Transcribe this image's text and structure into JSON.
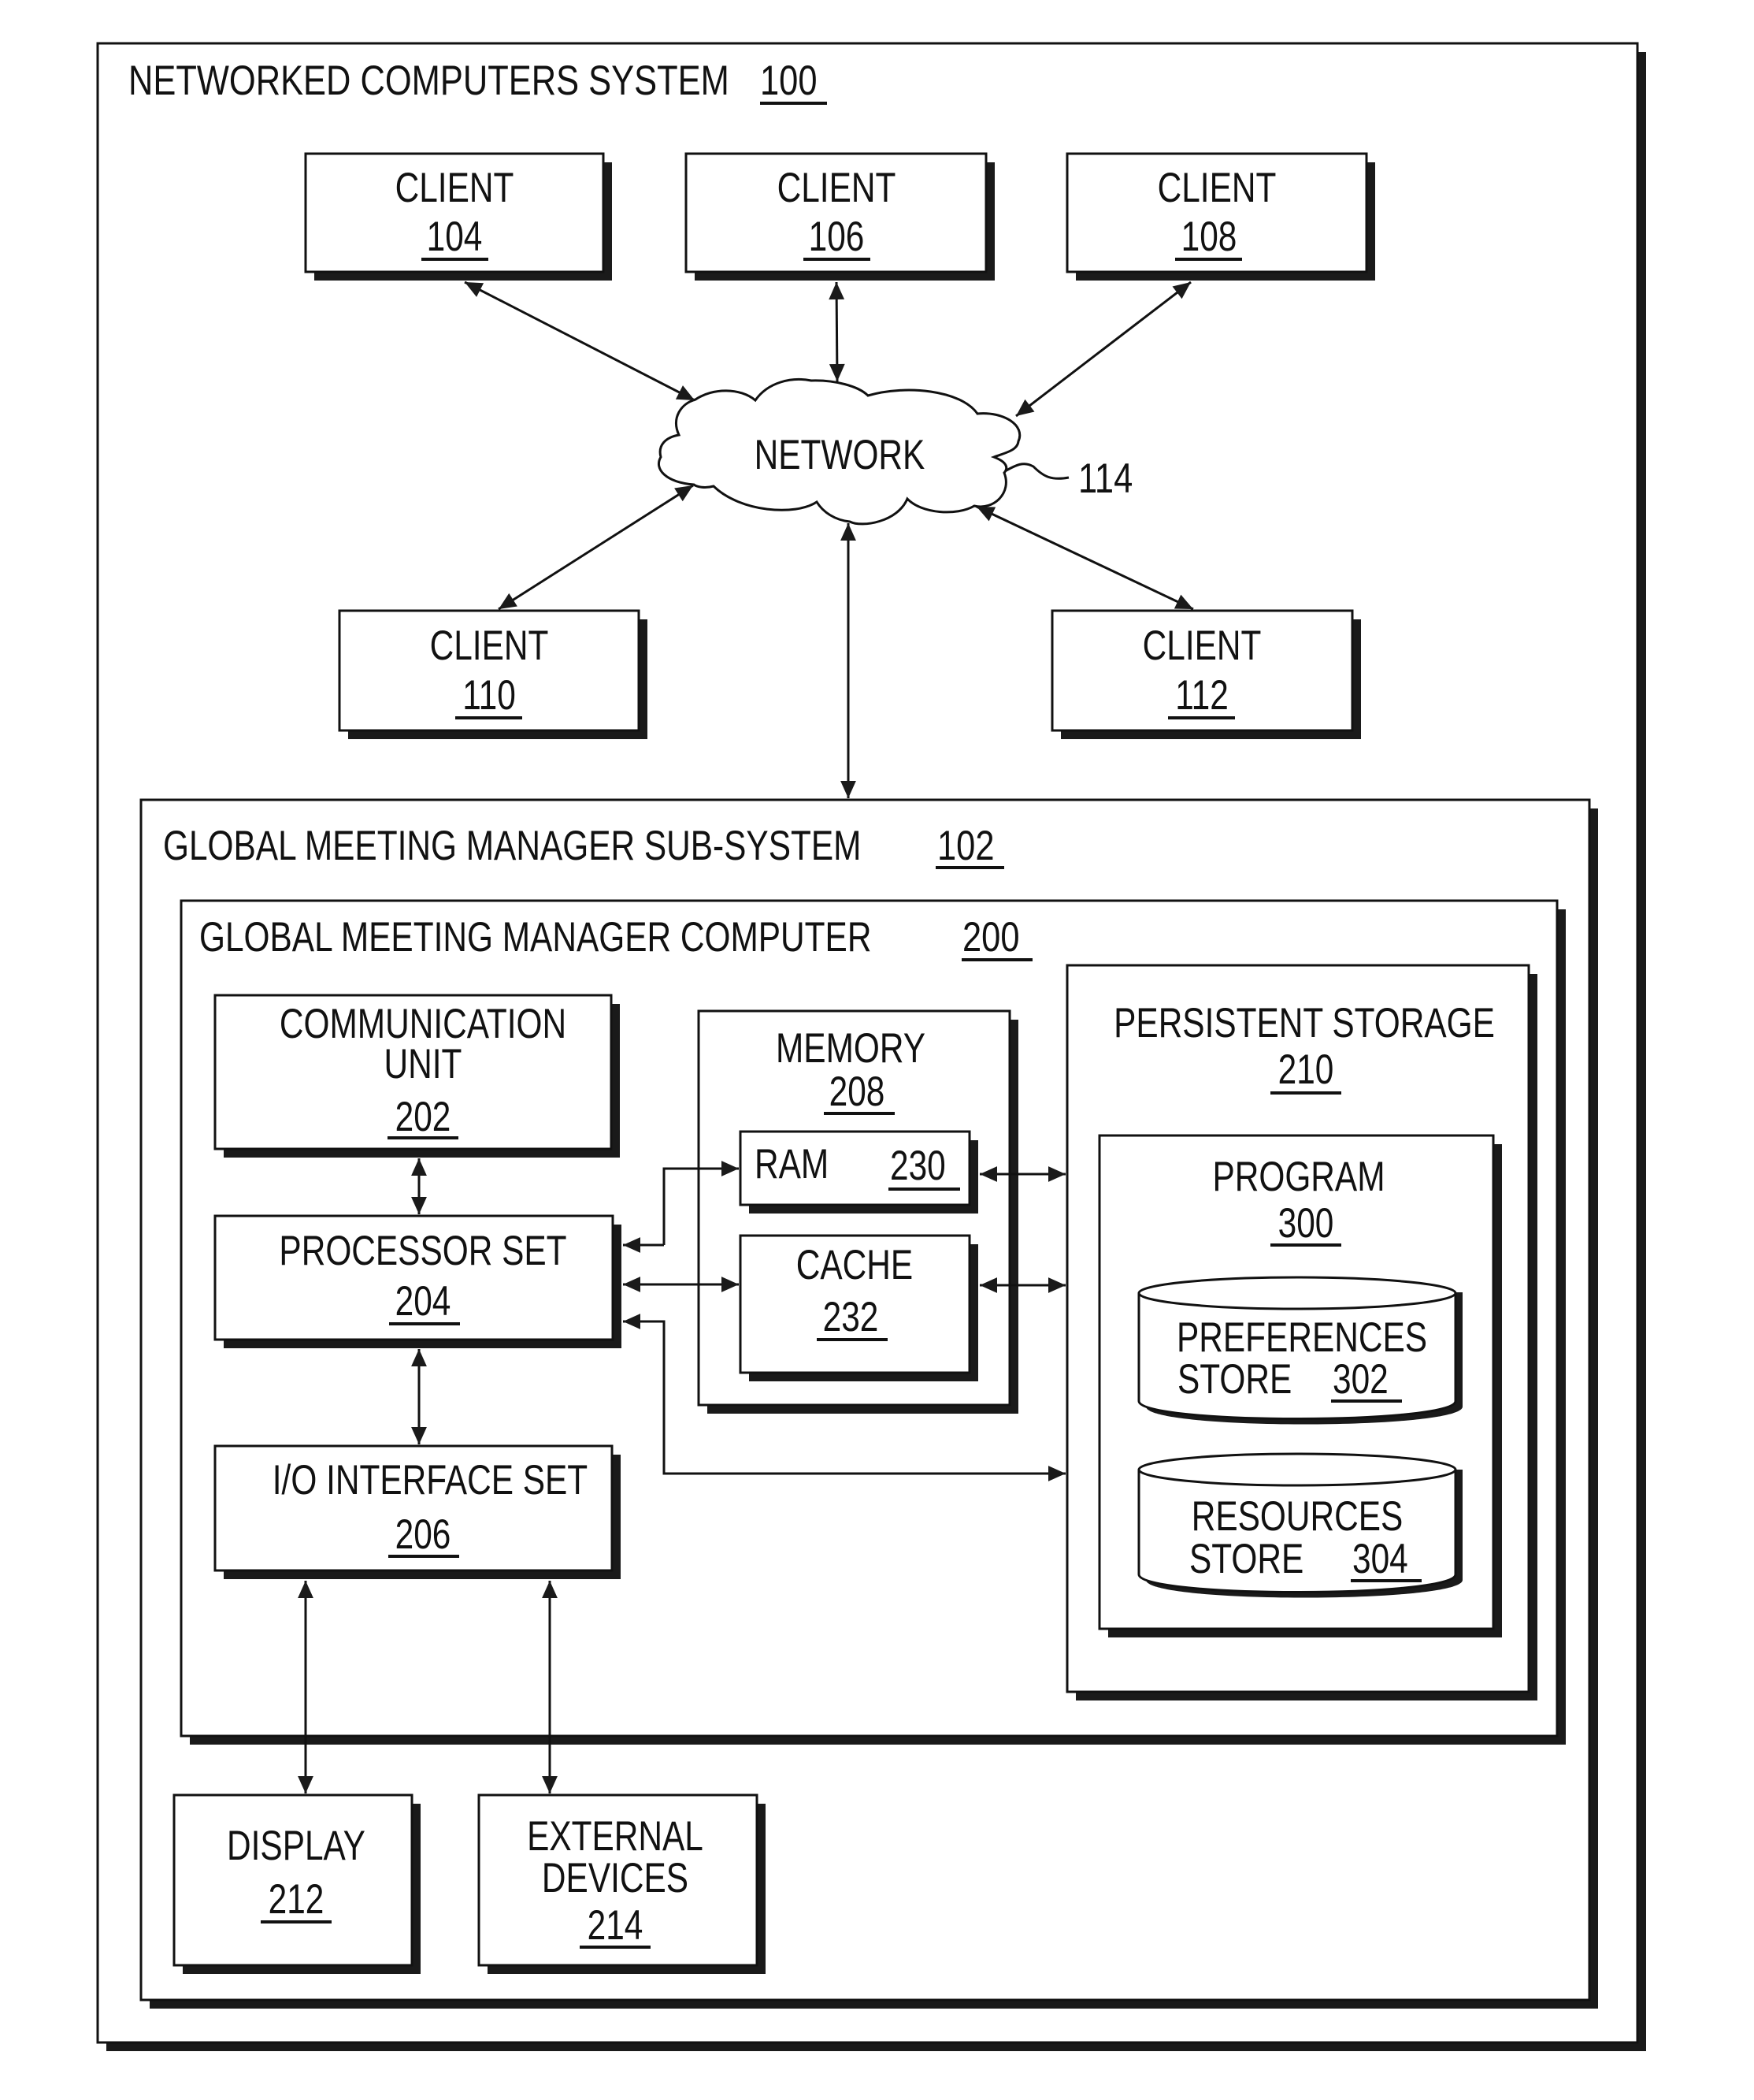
{
  "system": {
    "title": "NETWORKED COMPUTERS SYSTEM",
    "ref": "100"
  },
  "network": {
    "label": "NETWORK",
    "ref": "114"
  },
  "clients": [
    {
      "label": "CLIENT",
      "ref": "104"
    },
    {
      "label": "CLIENT",
      "ref": "106"
    },
    {
      "label": "CLIENT",
      "ref": "108"
    },
    {
      "label": "CLIENT",
      "ref": "110"
    },
    {
      "label": "CLIENT",
      "ref": "112"
    }
  ],
  "subsystem": {
    "title": "GLOBAL MEETING MANAGER SUB-SYSTEM",
    "ref": "102"
  },
  "computer": {
    "title": "GLOBAL MEETING MANAGER COMPUTER",
    "ref": "200"
  },
  "comm_unit": {
    "line1": "COMMUNICATION",
    "line2": "UNIT",
    "ref": "202"
  },
  "processor": {
    "label": "PROCESSOR SET",
    "ref": "204"
  },
  "io": {
    "label": "I/O INTERFACE SET",
    "ref": "206"
  },
  "memory": {
    "label": "MEMORY",
    "ref": "208"
  },
  "ram": {
    "label": "RAM",
    "ref": "230"
  },
  "cache": {
    "label": "CACHE",
    "ref": "232"
  },
  "persistent": {
    "label": "PERSISTENT STORAGE",
    "ref": "210"
  },
  "program": {
    "label": "PROGRAM",
    "ref": "300"
  },
  "preferences": {
    "line1": "PREFERENCES",
    "line2": "STORE",
    "ref": "302"
  },
  "resources": {
    "line1": "RESOURCES",
    "line2": "STORE",
    "ref": "304"
  },
  "display": {
    "label": "DISPLAY",
    "ref": "212"
  },
  "external": {
    "line1": "EXTERNAL",
    "line2": "DEVICES",
    "ref": "214"
  }
}
